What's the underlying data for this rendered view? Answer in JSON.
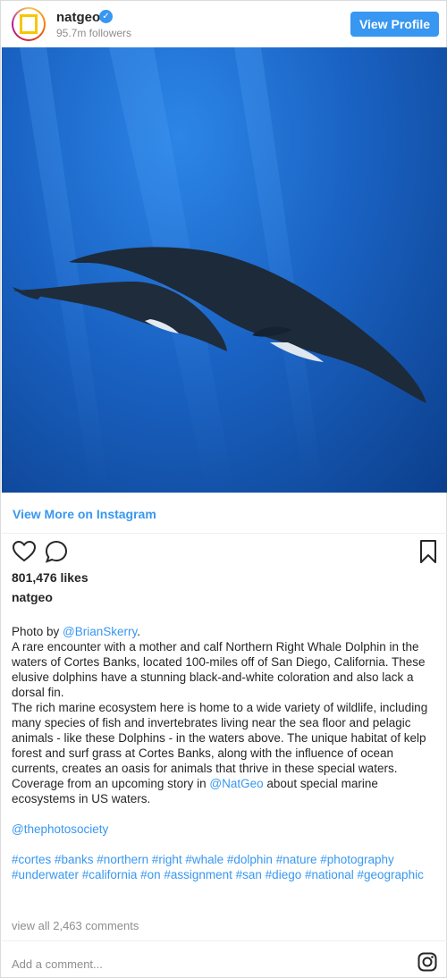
{
  "header": {
    "username": "natgeo",
    "followers": "95.7m followers",
    "view_profile": "View Profile"
  },
  "view_more": "View More on Instagram",
  "likes": "801,476 likes",
  "owner": "natgeo",
  "caption": {
    "line1_prefix": "Photo by ",
    "photographer": "@BrianSkerry",
    "line1_suffix": ".",
    "p2": "A rare encounter with a mother and calf Northern Right Whale Dolphin in the waters of Cortes Banks, located 100-miles off of San Diego, California. These elusive dolphins have a stunning black-and-white coloration and also lack a dorsal fin.",
    "p3_prefix": "The rich marine ecosystem here is home to a wide variety of wildlife, including many species of fish and invertebrates living near the sea floor and pelagic animals - like these Dolphins - in the waters above. The unique habitat of kelp forest and surf grass at Cortes Banks, along with the influence of ocean currents, creates an oasis for animals that thrive in these special waters. Coverage from an upcoming story in ",
    "p3_mention": "@NatGeo",
    "p3_suffix": " about special marine ecosystems in US waters.",
    "society": "@thephotosociety",
    "hashtags": "#cortes #banks #northern #right #whale #dolphin #nature #photography #underwater #california #on #assignment #san #diego #national #geographic"
  },
  "view_all": "view all 2,463 comments",
  "add_comment_placeholder": "Add a comment...",
  "colors": {
    "accent": "#3897f0",
    "ocean": "#1a63c4"
  },
  "icons": {
    "verified": "verified-badge-icon",
    "like": "heart-icon",
    "comment": "comment-bubble-icon",
    "save": "bookmark-icon",
    "instagram": "instagram-logo-icon"
  }
}
